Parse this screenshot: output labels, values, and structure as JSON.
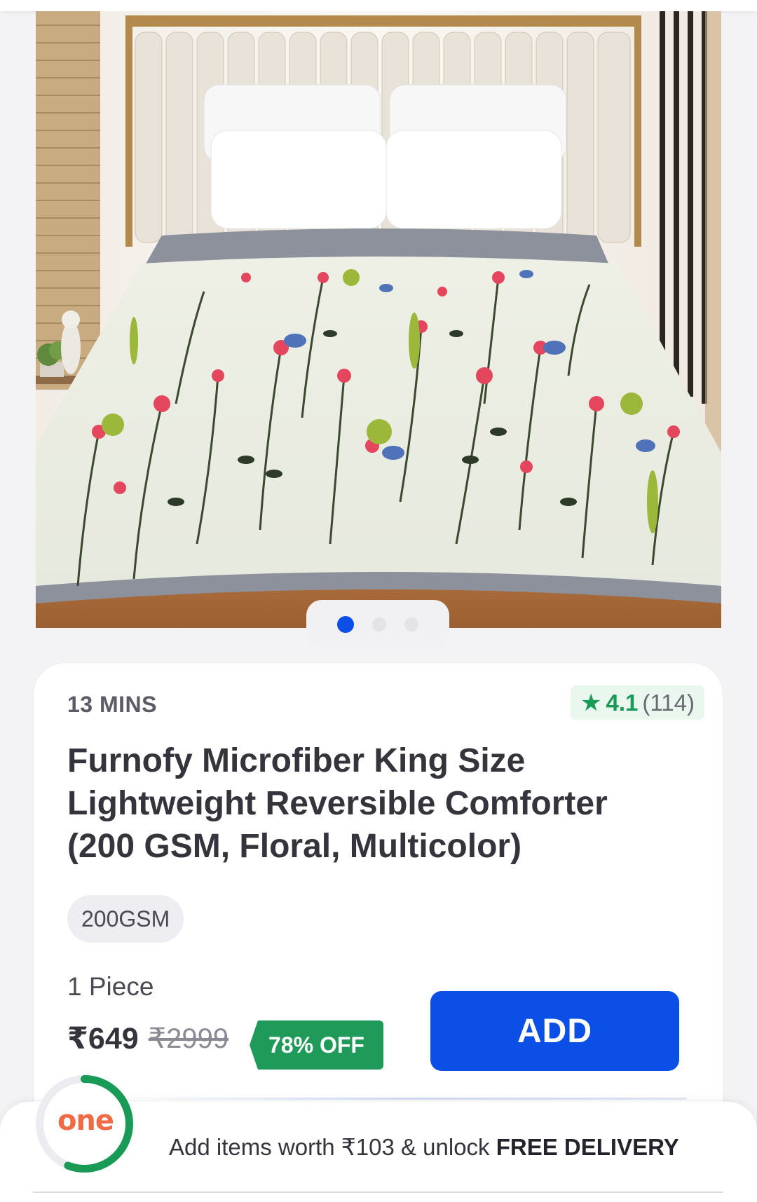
{
  "product": {
    "eta": "13 MINS",
    "rating": {
      "value": "4.1",
      "count": "(114)"
    },
    "title": "Furnofy Microfiber King Size Lightweight Reversible Comforter (200 GSM, Floral, Multicolor)",
    "variant": "200GSM",
    "quantity": "1 Piece",
    "price": "₹649",
    "mrp": "₹2999",
    "discount": "78% OFF",
    "add_label": "ADD"
  },
  "carousel": {
    "total": 3,
    "active": 1
  },
  "delivery": {
    "text_prefix": "Add items worth ₹103 & unlock ",
    "text_bold": "FREE DELIVERY",
    "logo": "one",
    "progress": 0.56
  },
  "colors": {
    "accent": "#0c4fe6",
    "success": "#1a9a57",
    "logo": "#f06a45"
  }
}
